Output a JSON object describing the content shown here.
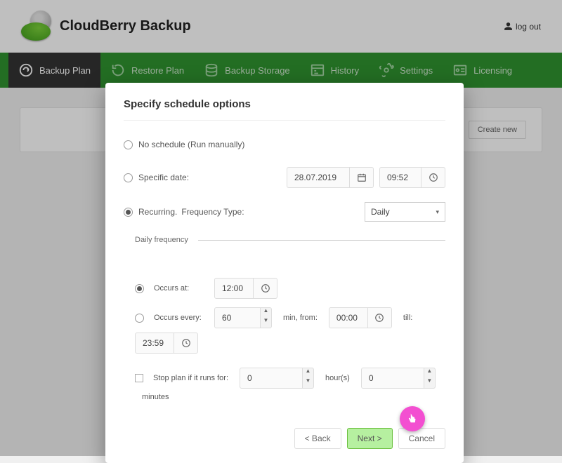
{
  "header": {
    "brand": "CloudBerry Backup",
    "logout": "log out"
  },
  "nav": {
    "backup": "Backup Plan",
    "restore": "Restore Plan",
    "storage": "Backup Storage",
    "history": "History",
    "settings": "Settings",
    "licensing": "Licensing"
  },
  "panel": {
    "create_new": "Create new"
  },
  "modal": {
    "title": "Specify schedule options",
    "no_schedule": "No schedule (Run manually)",
    "specific_date": "Specific date:",
    "date_value": "28.07.2019",
    "time_value": "09:52",
    "recurring": "Recurring.",
    "freq_label": "Frequency Type:",
    "freq_value": "Daily",
    "section_daily": "Daily frequency",
    "occurs_at": "Occurs at:",
    "occurs_at_value": "12:00",
    "occurs_every": "Occurs every:",
    "occurs_every_value": "60",
    "occurs_every_unit": "min, from:",
    "from_value": "00:00",
    "till_label": "till:",
    "till_value": "23:59",
    "stop_label": "Stop plan if it runs for:",
    "stop_hours": "0",
    "stop_hours_unit": "hour(s)",
    "stop_min": "0",
    "stop_min_unit": "minutes",
    "back_btn": "< Back",
    "next_btn": "Next >",
    "cancel_btn": "Cancel"
  }
}
